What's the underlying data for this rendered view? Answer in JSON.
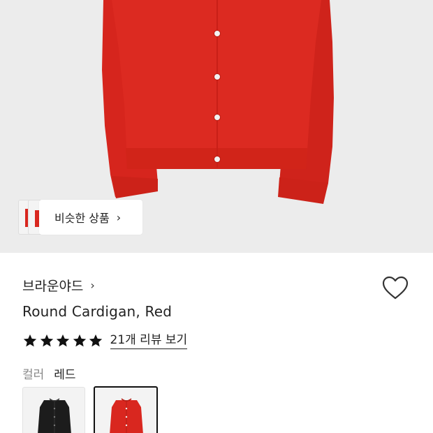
{
  "hero": {
    "similar_label": "비슷한 상품",
    "similar_chevron": "›"
  },
  "product": {
    "brand": "브라운야드",
    "brand_chevron": "›",
    "title": "Round Cardigan, Red",
    "rating_stars": 5,
    "review_link": "21개 리뷰 보기",
    "color_label": "컬러",
    "color_value": "레드",
    "swatches": [
      {
        "name": "black",
        "color": "#1c1c1c",
        "selected": false
      },
      {
        "name": "red",
        "color": "#d9271f",
        "selected": true
      }
    ]
  },
  "colors": {
    "background_hero": "#ececec",
    "cardigan_red": "#d9271f",
    "star": "#111111"
  },
  "icons": {
    "favorite": "heart-outline-icon",
    "star": "star-filled-icon"
  }
}
